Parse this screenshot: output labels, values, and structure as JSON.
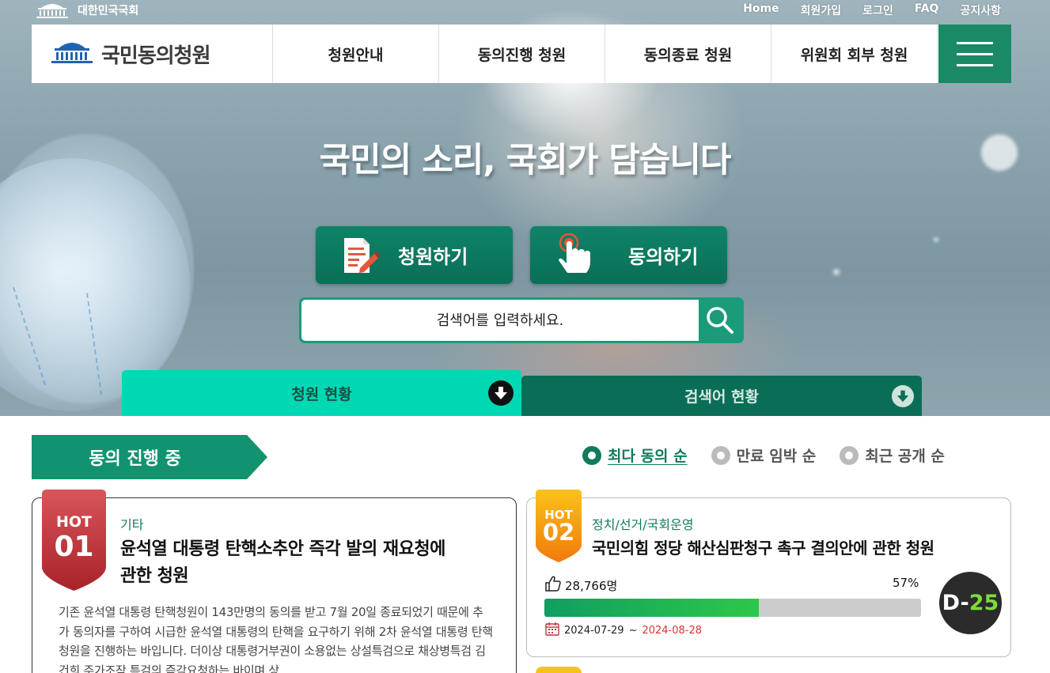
{
  "header": {
    "assembly_label": "대한민국국회",
    "util_links": [
      "Home",
      "회원가입",
      "로그인",
      "FAQ",
      "공지사항"
    ],
    "logo_text": "국민동의청원",
    "nav_items": [
      "청원안내",
      "동의진행 청원",
      "동의종료 청원",
      "위원회 회부 청원"
    ],
    "menu_icon": "hamburger-icon"
  },
  "hero": {
    "title": "국민의 소리, 국회가 담습니다",
    "petition_button": "청원하기",
    "consent_button": "동의하기",
    "search_placeholder": "검색어를 입력하세요.",
    "tabs": [
      {
        "label": "청원 현황",
        "active": true
      },
      {
        "label": "검색어 현황",
        "active": false
      }
    ]
  },
  "section": {
    "badge": "동의 진행 중",
    "sort_options": [
      {
        "label": "최다 동의 순",
        "selected": true
      },
      {
        "label": "만료 임박 순",
        "selected": false
      },
      {
        "label": "최근 공개 순",
        "selected": false
      }
    ]
  },
  "cards": [
    {
      "hot_label": "HOT",
      "rank": "01",
      "category": "기타",
      "title_line1": "윤석열 대통령 탄핵소추안 즉각 발의 재요청에",
      "title_line2": "관한 청원",
      "summary": "기존 윤석열 대통령 탄핵청원이 143만명의 동의를 받고 7월 20일 종료되었기 때문에 추가 동의자를 구하여 시급한 윤석열 대통령의 탄핵을 요구하기 위해 2차 윤석열 대통령 탄핵청원을 진행하는 바입니다. 더이상 대통령거부권이 소용없는 상설특검으로 채상병특검 김건희 주가조작 특검의 즉각요청하는 바이며 상"
    },
    {
      "hot_label": "HOT",
      "rank": "02",
      "category": "정치/선거/국회운영",
      "title": "국민의힘 정당 해산심판청구 촉구 결의안에 관한 청원",
      "count": "28,766명",
      "percent_label": "57%",
      "progress": 0.57,
      "start_date": "2024-07-29",
      "date_sep": "~",
      "end_date": "2024-08-28",
      "dday_prefix": "D-",
      "dday_num": "25"
    }
  ],
  "colors": {
    "primary": "#127a5d",
    "nav_menu": "#1a8a66",
    "tab_active": "#00d8b4",
    "tab_inactive": "#0a6e56",
    "hot1": "#c0333a",
    "hot2": "#f08a10",
    "progress": "#2cc84a",
    "dday_green": "#7bdc3a",
    "end_date": "#dd3333"
  }
}
